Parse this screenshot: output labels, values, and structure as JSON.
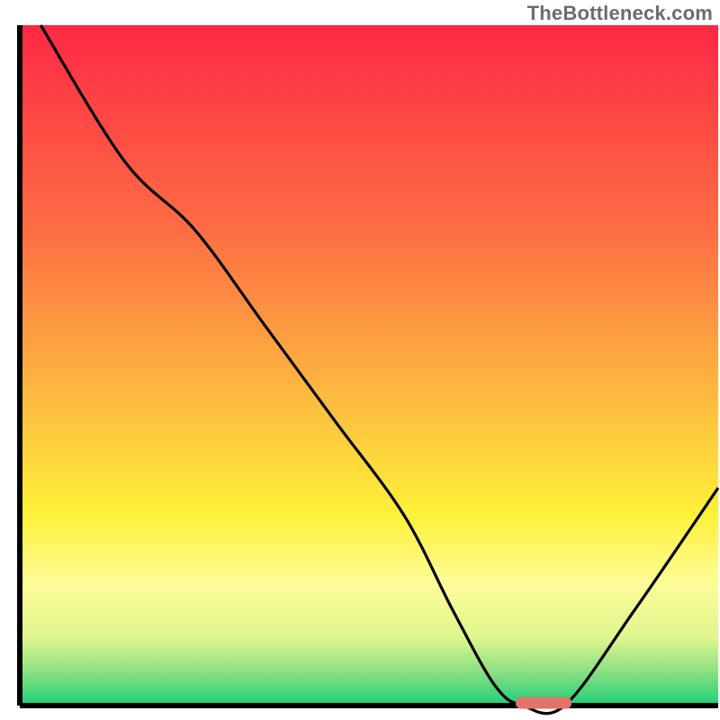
{
  "watermark": "TheBottleneck.com",
  "chart_data": {
    "type": "line",
    "title": "",
    "xlabel": "",
    "ylabel": "",
    "xlim": [
      0,
      100
    ],
    "ylim": [
      0,
      100
    ],
    "grid": false,
    "legend": false,
    "series": [
      {
        "name": "bottleneck-curve",
        "x": [
          3,
          15,
          25,
          35,
          45,
          55,
          62,
          68,
          72,
          78,
          88,
          100
        ],
        "y": [
          100,
          80,
          70,
          56,
          42,
          28,
          14,
          3,
          0,
          0,
          14,
          32
        ]
      }
    ],
    "marker": {
      "name": "optimal-range",
      "x_start": 71,
      "x_end": 79,
      "y": 0,
      "color": "#e2736b"
    },
    "background_gradient": {
      "stops": [
        {
          "offset": 0.0,
          "color": "#fe2945"
        },
        {
          "offset": 0.3,
          "color": "#fd6d44"
        },
        {
          "offset": 0.55,
          "color": "#fdbb40"
        },
        {
          "offset": 0.72,
          "color": "#fef139"
        },
        {
          "offset": 0.82,
          "color": "#fefc98"
        },
        {
          "offset": 0.9,
          "color": "#dff58e"
        },
        {
          "offset": 0.95,
          "color": "#8be082"
        },
        {
          "offset": 1.0,
          "color": "#1dce7a"
        }
      ]
    },
    "axis_color": "#000000",
    "curve_color": "#000000"
  }
}
